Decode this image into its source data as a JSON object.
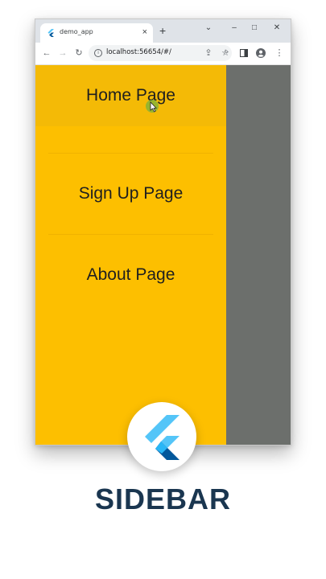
{
  "browser": {
    "tab_title": "demo_app",
    "tab_close": "×",
    "new_tab": "+",
    "window_controls": {
      "dropdown": "⌄",
      "minimize": "–",
      "maximize": "□",
      "close": "✕"
    },
    "url": "localhost:56654/#/",
    "icons": [
      "back-icon",
      "forward-icon",
      "reload-icon",
      "site-info-icon",
      "zoom-icon",
      "share-icon",
      "bookmark-star-icon",
      "side-panel-icon",
      "profile-icon",
      "menu-icon"
    ]
  },
  "drawer": {
    "items": [
      {
        "label": "Home Page",
        "hovered": true
      },
      {
        "label": "Sign Up Page",
        "hovered": false
      },
      {
        "label": "About Page",
        "hovered": false
      }
    ],
    "background_color": "#fdbf00",
    "scrim_color": "#6c6f6c"
  },
  "caption": "SIDEBAR",
  "logo": {
    "name": "flutter-logo",
    "colors": [
      "#54c5f8",
      "#01579b",
      "#29b6f6"
    ]
  }
}
